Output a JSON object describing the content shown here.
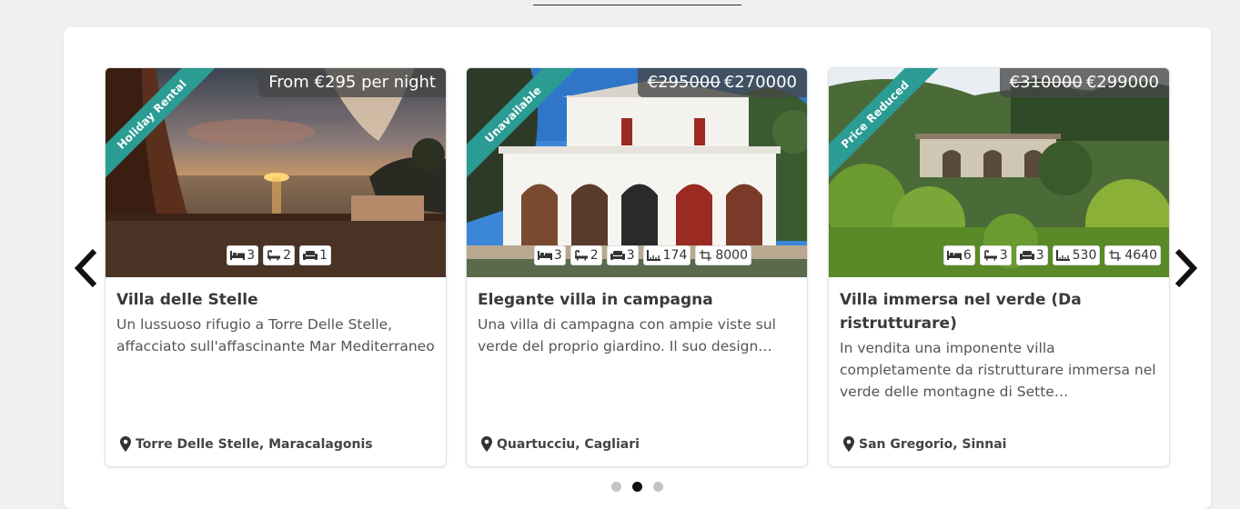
{
  "carousel": {
    "prev_label": "Previous",
    "next_label": "Next",
    "dots": [
      {
        "active": false
      },
      {
        "active": true
      },
      {
        "active": false
      }
    ]
  },
  "cards": [
    {
      "ribbon": "Holiday Rental",
      "price_old": "",
      "price": "From €295 per night",
      "features": [
        {
          "icon": "bed-icon",
          "value": "3"
        },
        {
          "icon": "bath-icon",
          "value": "2"
        },
        {
          "icon": "sofa-icon",
          "value": "1"
        }
      ],
      "title": "Villa delle Stelle",
      "description": "Un lussuoso rifugio a Torre Delle Stelle, affacciato sull'affascinante Mar Mediterraneo",
      "location": "Torre Delle Stelle, Maracalagonis"
    },
    {
      "ribbon": "Unavailable",
      "price_old": "€295000",
      "price": "€270000",
      "features": [
        {
          "icon": "bed-icon",
          "value": "3"
        },
        {
          "icon": "bath-icon",
          "value": "2"
        },
        {
          "icon": "sofa-icon",
          "value": "3"
        },
        {
          "icon": "ruler-icon",
          "value": "174"
        },
        {
          "icon": "crop-icon",
          "value": "8000"
        }
      ],
      "title": "Elegante villa in campagna",
      "description": "Una villa di campagna con ampie viste sul verde del proprio giardino.  Il suo design…",
      "location": "Quartucciu, Cagliari"
    },
    {
      "ribbon": "Price Reduced",
      "price_old": "€310000",
      "price": "€299000",
      "features": [
        {
          "icon": "bed-icon",
          "value": "6"
        },
        {
          "icon": "bath-icon",
          "value": "3"
        },
        {
          "icon": "sofa-icon",
          "value": "3"
        },
        {
          "icon": "ruler-icon",
          "value": "530"
        },
        {
          "icon": "crop-icon",
          "value": "4640"
        }
      ],
      "title": "Villa immersa nel verde (Da ristrutturare)",
      "description": "In vendita una imponente villa completamente da ristrutturare immersa nel verde delle montagne di Sette…",
      "location": "San Gregorio, Sinnai"
    }
  ],
  "colors": {
    "ribbon": "#2a9c94",
    "price_tag": "#464646",
    "active_dot": "#111111"
  }
}
